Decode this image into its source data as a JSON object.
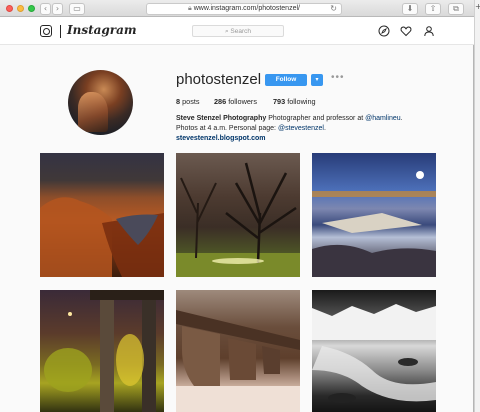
{
  "browser": {
    "url": "www.instagram.com/photostenzel/"
  },
  "header": {
    "brand": "Instagram",
    "search_placeholder": "Search"
  },
  "profile": {
    "username": "photostenzel",
    "follow_label": "Follow",
    "more_label": "•••",
    "stats": {
      "posts_count": "8",
      "posts_label": "posts",
      "followers_count": "286",
      "followers_label": "followers",
      "following_count": "793",
      "following_label": "following"
    },
    "bio": {
      "name": "Steve Stenzel Photography",
      "text1": "Photographer and professor at",
      "mention1": "@hamlineu",
      "text2": ". Photos at 4 a.m. Personal page:",
      "mention2": "@stevestenzel",
      "text3": ".",
      "website": "stevestenzel.blogspot.com"
    }
  },
  "icons": {
    "back": "chevron-left-icon",
    "forward": "chevron-right-icon",
    "sidebar": "sidebar-icon",
    "lock": "lock-icon",
    "reload": "reload-icon",
    "download": "download-icon",
    "share": "share-icon",
    "tabs": "tabs-icon",
    "explore": "compass-icon",
    "activity": "heart-icon",
    "profile": "person-icon",
    "instagram": "camera-icon"
  },
  "colors": {
    "accent": "#3897f0",
    "link": "#003569"
  }
}
